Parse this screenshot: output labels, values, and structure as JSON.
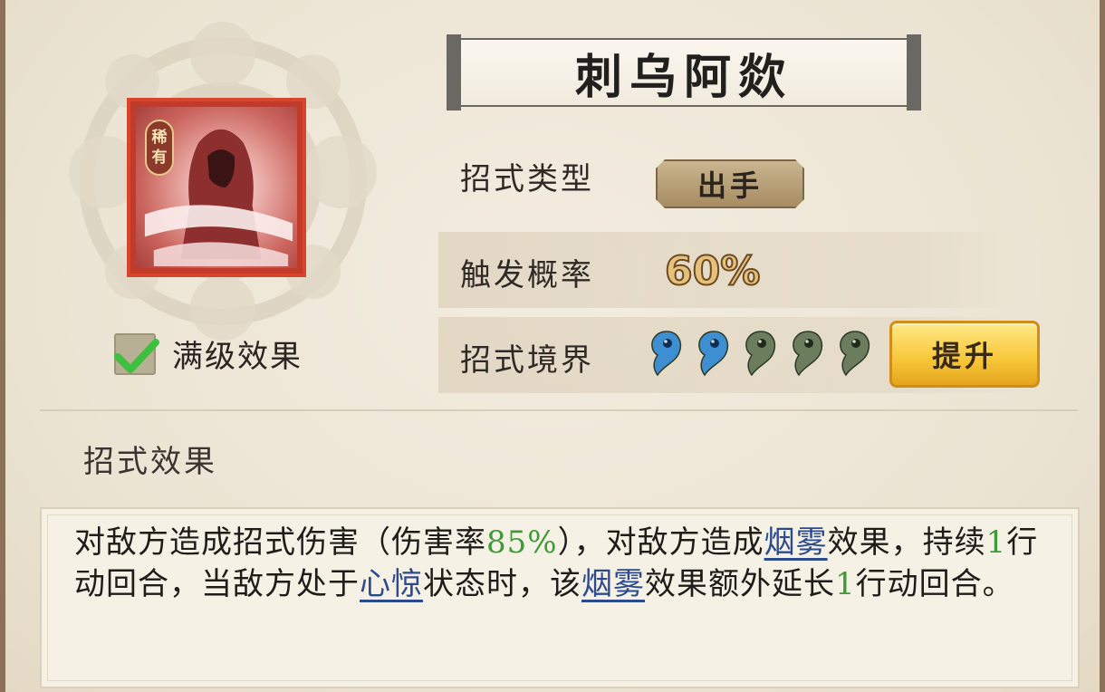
{
  "skill": {
    "name": "刺乌阿欻",
    "rarity_badge": [
      "稀",
      "有"
    ],
    "max_level_checkbox_label": "满级效果",
    "max_level_checked": true
  },
  "stats": {
    "type_label": "招式类型",
    "type_value": "出手",
    "trigger_label": "触发概率",
    "trigger_value": "60%",
    "realm_label": "招式境界",
    "realm_level": 2,
    "realm_max": 5,
    "upgrade_button": "提升"
  },
  "effect": {
    "section_title": "招式效果",
    "segments": [
      {
        "t": "对敌方造成招式伤害（伤害率"
      },
      {
        "t": "85%",
        "s": "green"
      },
      {
        "t": "），对敌方造成"
      },
      {
        "t": "烟雾",
        "s": "link"
      },
      {
        "t": "效果，持续"
      },
      {
        "t": "1",
        "s": "green"
      },
      {
        "t": "行动回合，当敌方处于"
      },
      {
        "t": "心惊",
        "s": "link"
      },
      {
        "t": "状态时，该"
      },
      {
        "t": "烟雾",
        "s": "link"
      },
      {
        "t": "效果额外延长"
      },
      {
        "t": "1",
        "s": "green"
      },
      {
        "t": "行动回合。"
      }
    ]
  },
  "colors": {
    "magatama_active": "#3d8fd1",
    "magatama_inactive": "#6b7d5c",
    "upgrade_button": "#f7c637",
    "highlight_number": "#3f9a3a",
    "highlight_link": "#2c4a8e"
  }
}
